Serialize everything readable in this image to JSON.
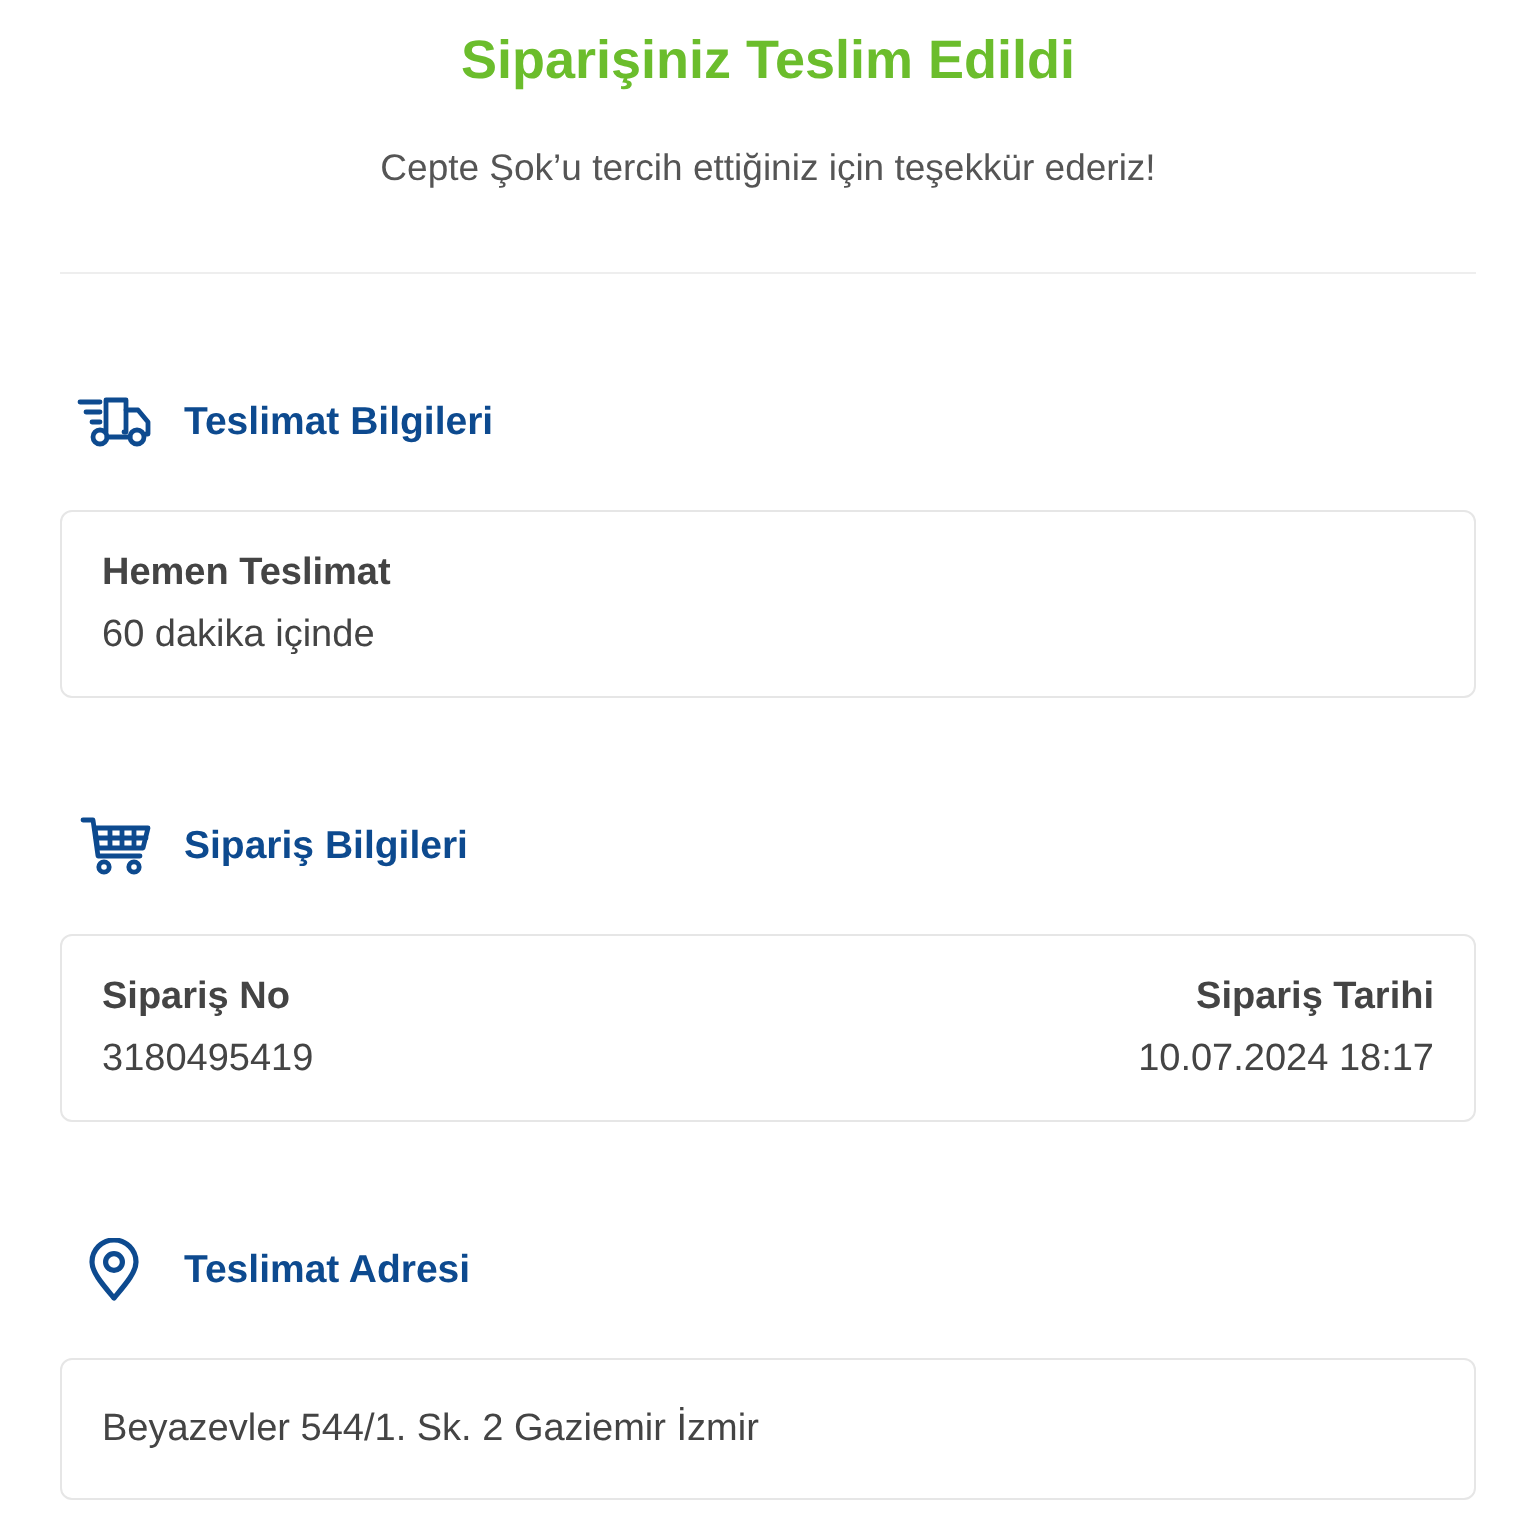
{
  "header": {
    "title": "Siparişiniz Teslim Edildi",
    "subtitle": "Cepte Şok’u tercih ettiğiniz için teşekkür ederiz!"
  },
  "sections": [
    {
      "kind": "delivery",
      "title": "Teslimat Bilgileri",
      "card": {
        "kind": "stack",
        "fields": [
          {
            "label": "Hemen Teslimat",
            "value": "60 dakika içinde"
          }
        ]
      }
    },
    {
      "kind": "order",
      "title": "Sipariş Bilgileri",
      "card": {
        "kind": "pair",
        "fields": [
          {
            "label": "Sipariş No",
            "value": "3180495419"
          },
          {
            "label": "Sipariş Tarihi",
            "value": "10.07.2024 18:17"
          }
        ]
      }
    },
    {
      "kind": "address",
      "title": "Teslimat Adresi",
      "card": {
        "kind": "line",
        "text": "Beyazevler 544/1. Sk. 2 Gaziemir İzmir"
      }
    }
  ]
}
